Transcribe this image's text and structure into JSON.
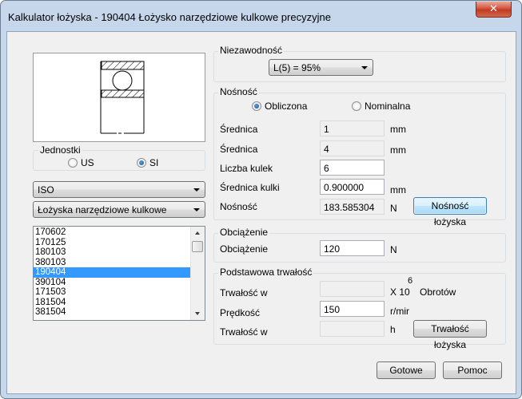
{
  "window": {
    "title": "Kalkulator łożyska - 190404 Łożysko narzędziowe kulkowe precyzyjne",
    "close_glyph": "✕"
  },
  "units": {
    "group_label": "Jednostki",
    "option_us": "US",
    "option_si": "SI",
    "selected": "SI"
  },
  "standard_combo": {
    "value": "ISO"
  },
  "type_combo": {
    "value": "Łożyska narzędziowe kulkowe"
  },
  "bearing_list": {
    "items": [
      "170602",
      "170125",
      "180103",
      "380103",
      "190404",
      "390104",
      "171503",
      "181504",
      "381504"
    ],
    "selected": "190404"
  },
  "reliability": {
    "group_label": "Niezawodność",
    "value": "L(5) = 95%"
  },
  "capacity": {
    "group_label": "Nośność",
    "option_calculated": "Obliczona",
    "option_nominal": "Nominalna",
    "selected": "Obliczona",
    "diameter1_label": "Średnica",
    "diameter1_value": "1",
    "diameter1_unit": "mm",
    "diameter2_label": "Średnica",
    "diameter2_value": "4",
    "diameter2_unit": "mm",
    "balls_count_label": "Liczba kulek",
    "balls_count_value": "6",
    "ball_diameter_label": "Średnica kulki",
    "ball_diameter_value": "0.900000",
    "ball_diameter_unit": "mm",
    "capacity_label": "Nośność",
    "capacity_value": "183.585304",
    "capacity_unit": "N",
    "capacity_button": "Nośność łożyska"
  },
  "load": {
    "group_label": "Obciążenie",
    "label": "Obciążenie",
    "value": "120",
    "unit": "N"
  },
  "life": {
    "group_label": "Podstawowa trwałość",
    "life1_label": "Trwałość w",
    "life1_value": "",
    "life1_unit_base": "X 10",
    "life1_unit_exp": "6",
    "life1_unit_suffix": "Obrotów",
    "speed_label": "Prędkość",
    "speed_value": "150",
    "speed_unit": "r/mir",
    "life2_label": "Trwałość w",
    "life2_value": "",
    "life2_unit": "h",
    "life_button": "Trwałość łożyska"
  },
  "footer": {
    "ok_button": "Gotowe",
    "help_button": "Pomoc"
  }
}
